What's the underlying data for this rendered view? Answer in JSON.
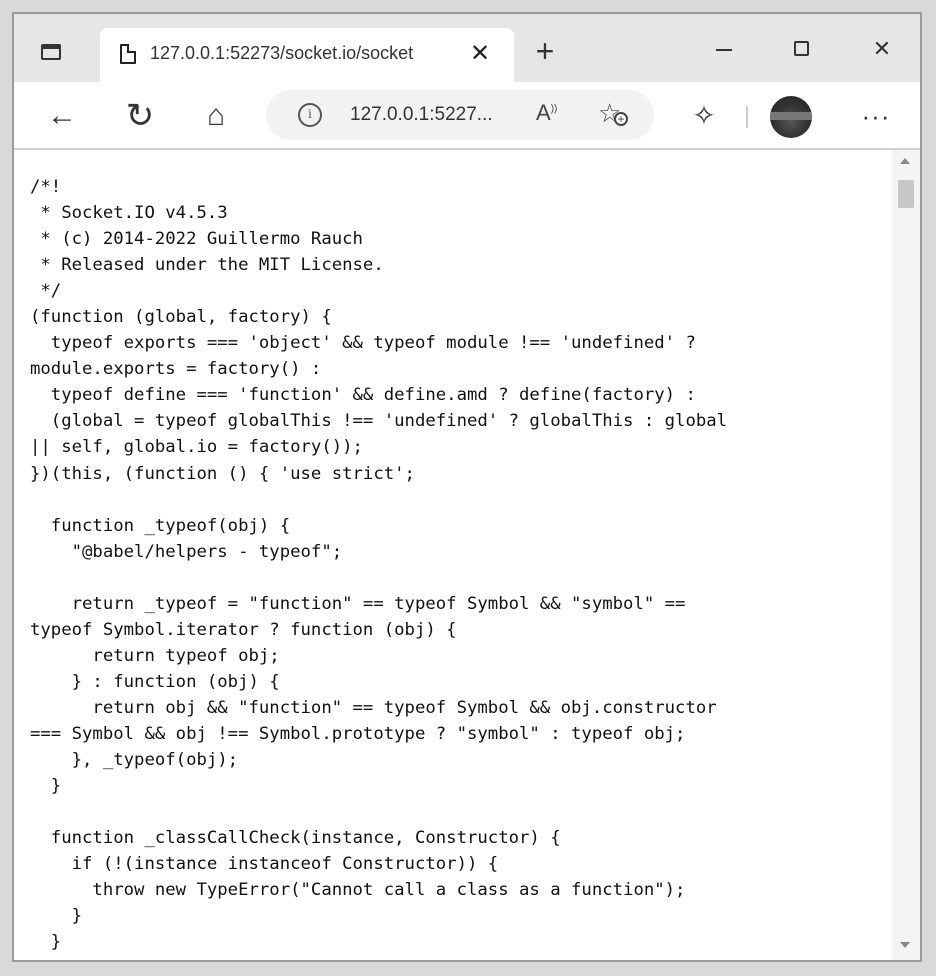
{
  "window": {
    "tab_actions_icon": "tab-actions-icon",
    "tab": {
      "title": "127.0.0.1:52273/socket.io/socket",
      "close_glyph": "✕"
    },
    "new_tab_glyph": "+",
    "controls": {
      "minimize_icon": "minimize-icon",
      "maximize_icon": "maximize-icon",
      "close_glyph": "✕"
    }
  },
  "toolbar": {
    "back_glyph": "←",
    "refresh_glyph": "↻",
    "home_glyph": "⌂",
    "address": {
      "info_glyph": "i",
      "url": "127.0.0.1:5227...",
      "read_aloud_glyph": "A",
      "favorites_glyph": "☆",
      "favorites_plus": "+"
    },
    "extensions_glyph": "✧",
    "more_glyph": "···"
  },
  "content": {
    "lines": [
      "/*!",
      " * Socket.IO v4.5.3",
      " * (c) 2014-2022 Guillermo Rauch",
      " * Released under the MIT License.",
      " */",
      "(function (global, factory) {",
      "  typeof exports === 'object' && typeof module !== 'undefined' ?",
      "module.exports = factory() :",
      "  typeof define === 'function' && define.amd ? define(factory) :",
      "  (global = typeof globalThis !== 'undefined' ? globalThis : global",
      "|| self, global.io = factory());",
      "})(this, (function () { 'use strict';",
      "",
      "  function _typeof(obj) {",
      "    \"@babel/helpers - typeof\";",
      "",
      "    return _typeof = \"function\" == typeof Symbol && \"symbol\" ==",
      "typeof Symbol.iterator ? function (obj) {",
      "      return typeof obj;",
      "    } : function (obj) {",
      "      return obj && \"function\" == typeof Symbol && obj.constructor",
      "=== Symbol && obj !== Symbol.prototype ? \"symbol\" : typeof obj;",
      "    }, _typeof(obj);",
      "  }",
      "",
      "  function _classCallCheck(instance, Constructor) {",
      "    if (!(instance instanceof Constructor)) {",
      "      throw new TypeError(\"Cannot call a class as a function\");",
      "    }",
      "  }"
    ]
  }
}
